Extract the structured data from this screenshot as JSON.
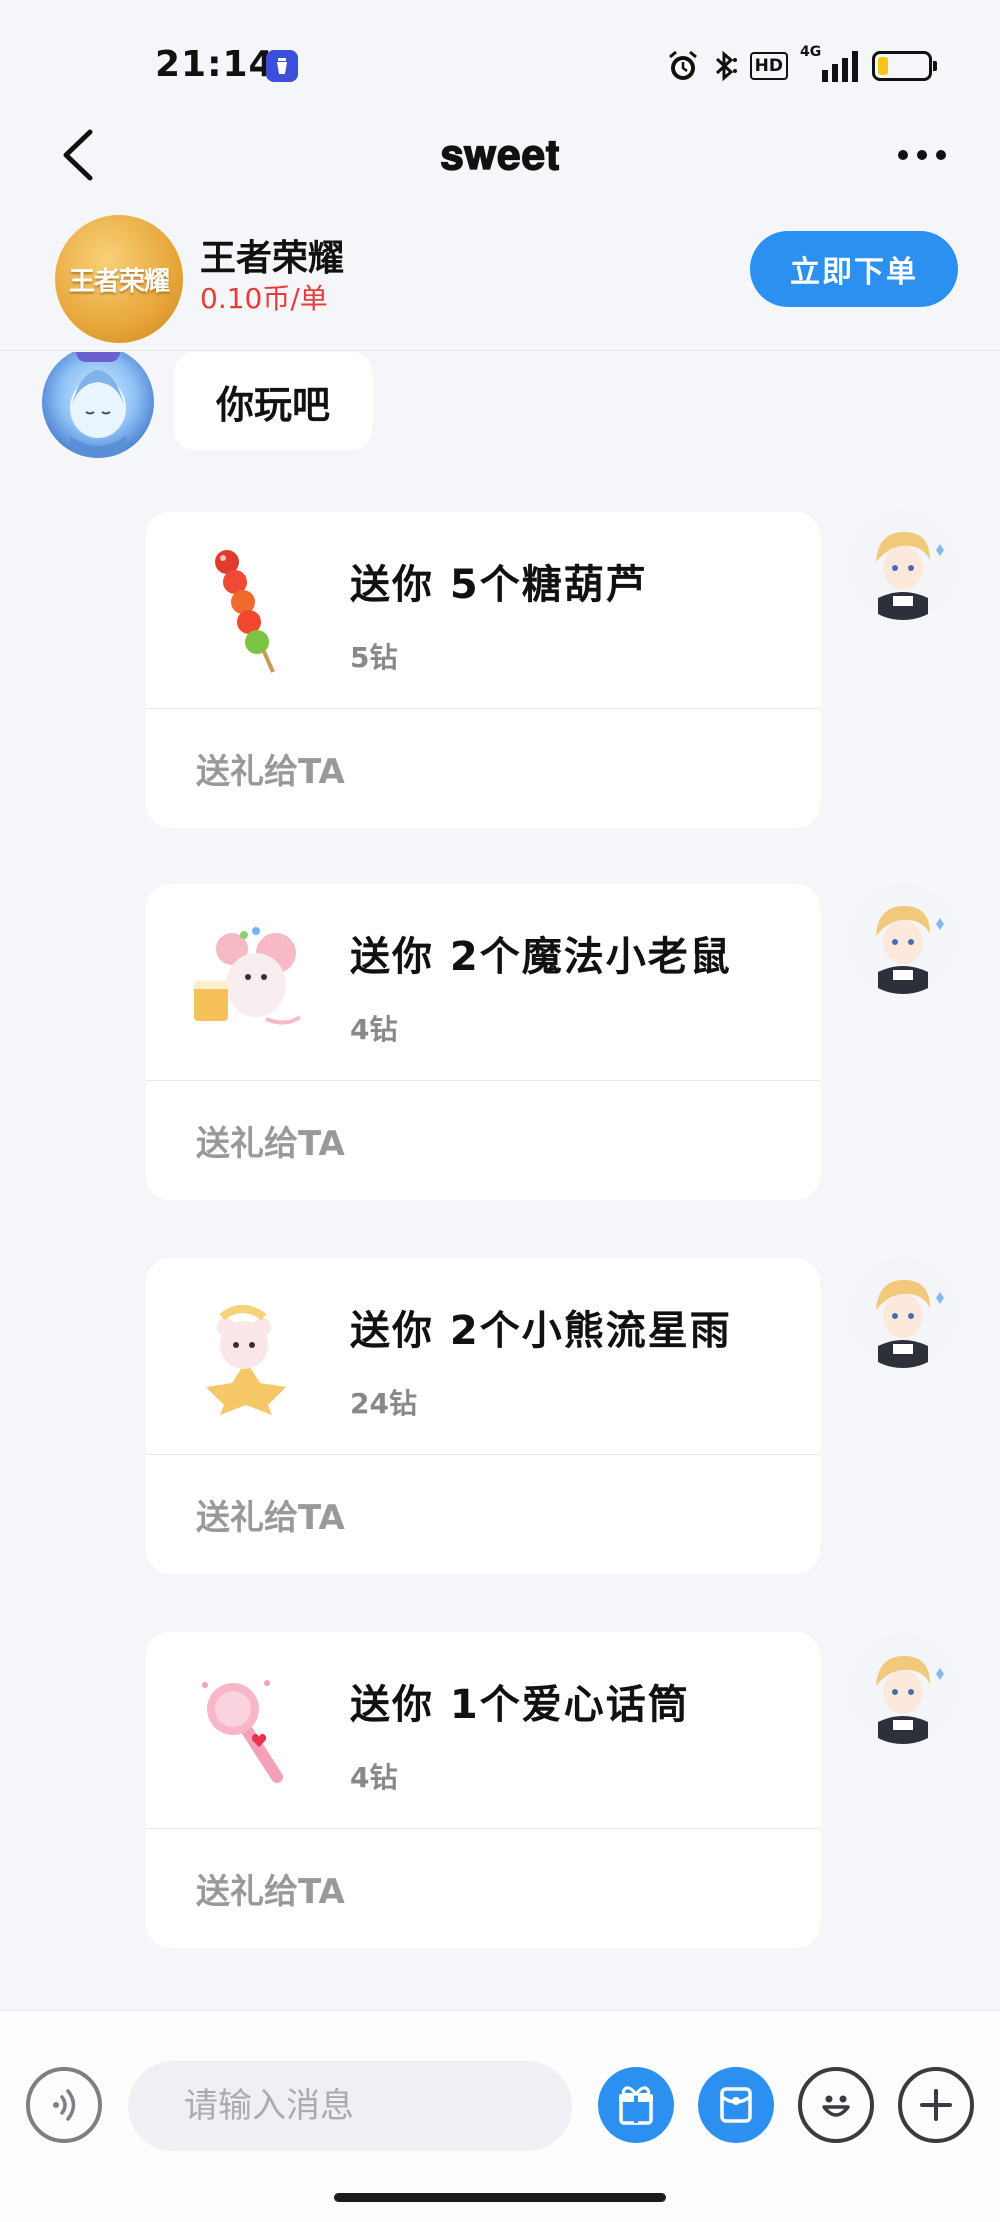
{
  "status_bar": {
    "time": "21:14",
    "hd_label": "HD",
    "network_label": "4G",
    "icons": [
      "app-notification-icon",
      "alarm-icon",
      "bluetooth-icon",
      "hd-icon",
      "signal-4g-icon",
      "battery-icon"
    ],
    "battery_level_percent": 20,
    "battery_color": "#f5c518"
  },
  "nav": {
    "title": "𝐬𝐰𝐞𝐞𝐭",
    "back_icon": "chevron-left-icon",
    "more_icon": "more-horizontal-icon"
  },
  "service": {
    "logo_text": "王者荣耀",
    "name": "王者荣耀",
    "price": "0.10币/单",
    "order_button": "立即下单",
    "accent_color": "#2b90f0",
    "price_color": "#ea3b3b"
  },
  "messages": {
    "incoming_text": "你玩吧",
    "gifts": [
      {
        "title": "送你 5个糖葫芦",
        "price": "5钻",
        "action": "送礼给TA",
        "icon": "candied-haws-icon"
      },
      {
        "title": "送你 2个魔法小老鼠",
        "price": "4钻",
        "action": "送礼给TA",
        "icon": "magic-mouse-icon"
      },
      {
        "title": "送你 2个小熊流星雨",
        "price": "24钻",
        "action": "送礼给TA",
        "icon": "bear-meteor-icon"
      },
      {
        "title": "送你 1个爱心话筒",
        "price": "4钻",
        "action": "送礼给TA",
        "icon": "heart-microphone-icon"
      }
    ]
  },
  "input_bar": {
    "placeholder": "请输入消息",
    "buttons": [
      "voice-icon",
      "gift-icon",
      "red-packet-icon",
      "emoji-icon",
      "plus-icon"
    ]
  }
}
